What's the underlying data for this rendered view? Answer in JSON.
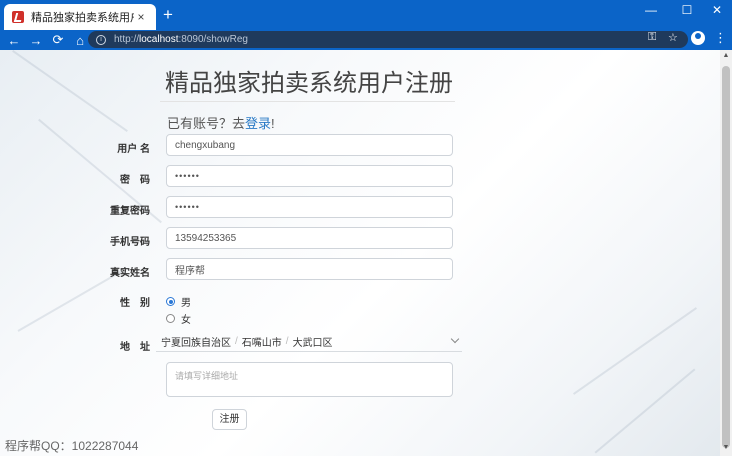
{
  "browser": {
    "tab_title": "精品独家拍卖系统用户注册",
    "tab_close": "×",
    "new_tab": "+",
    "window_controls": [
      "—",
      "☐",
      "✕"
    ],
    "nav": [
      "←",
      "→",
      "⟳",
      "⌂"
    ],
    "url_scheme": "http://",
    "url_host": "localhost",
    "url_rest": ":8090/showReg",
    "icons": [
      "key-icon",
      "star-icon",
      "account-icon",
      "menu-icon"
    ],
    "omnibox_glyphs": {
      "key": "⚿",
      "star": "☆"
    },
    "menu": "⋮",
    "accent": "#0b64c8"
  },
  "page": {
    "heading": "精品独家拍卖系统用户注册",
    "login_prefix": "已有账号？去",
    "login_link": "登录",
    "login_suffix": "!",
    "form": {
      "username_label": "用户 名",
      "username_value": "chengxubang",
      "password_label": "密　码",
      "password_value": "••••••",
      "repassword_label": "重复密码",
      "repassword_value": "••••••",
      "phone_label": "手机号码",
      "phone_value": "13594253365",
      "realname_label": "真实姓名",
      "realname_value": "程序帮",
      "gender_label": "性　别",
      "gender_male": "男",
      "gender_female": "女",
      "address_label": "地　址",
      "province": "宁夏回族自治区",
      "city": "石嘴山市",
      "district": "大武口区",
      "separator": "/",
      "detail_placeholder": "请填写详细地址",
      "submit_label": "注册"
    },
    "footer": "程序帮QQ：1022287044",
    "scroll_arrows": {
      "up": "▲",
      "down": "▼"
    }
  }
}
